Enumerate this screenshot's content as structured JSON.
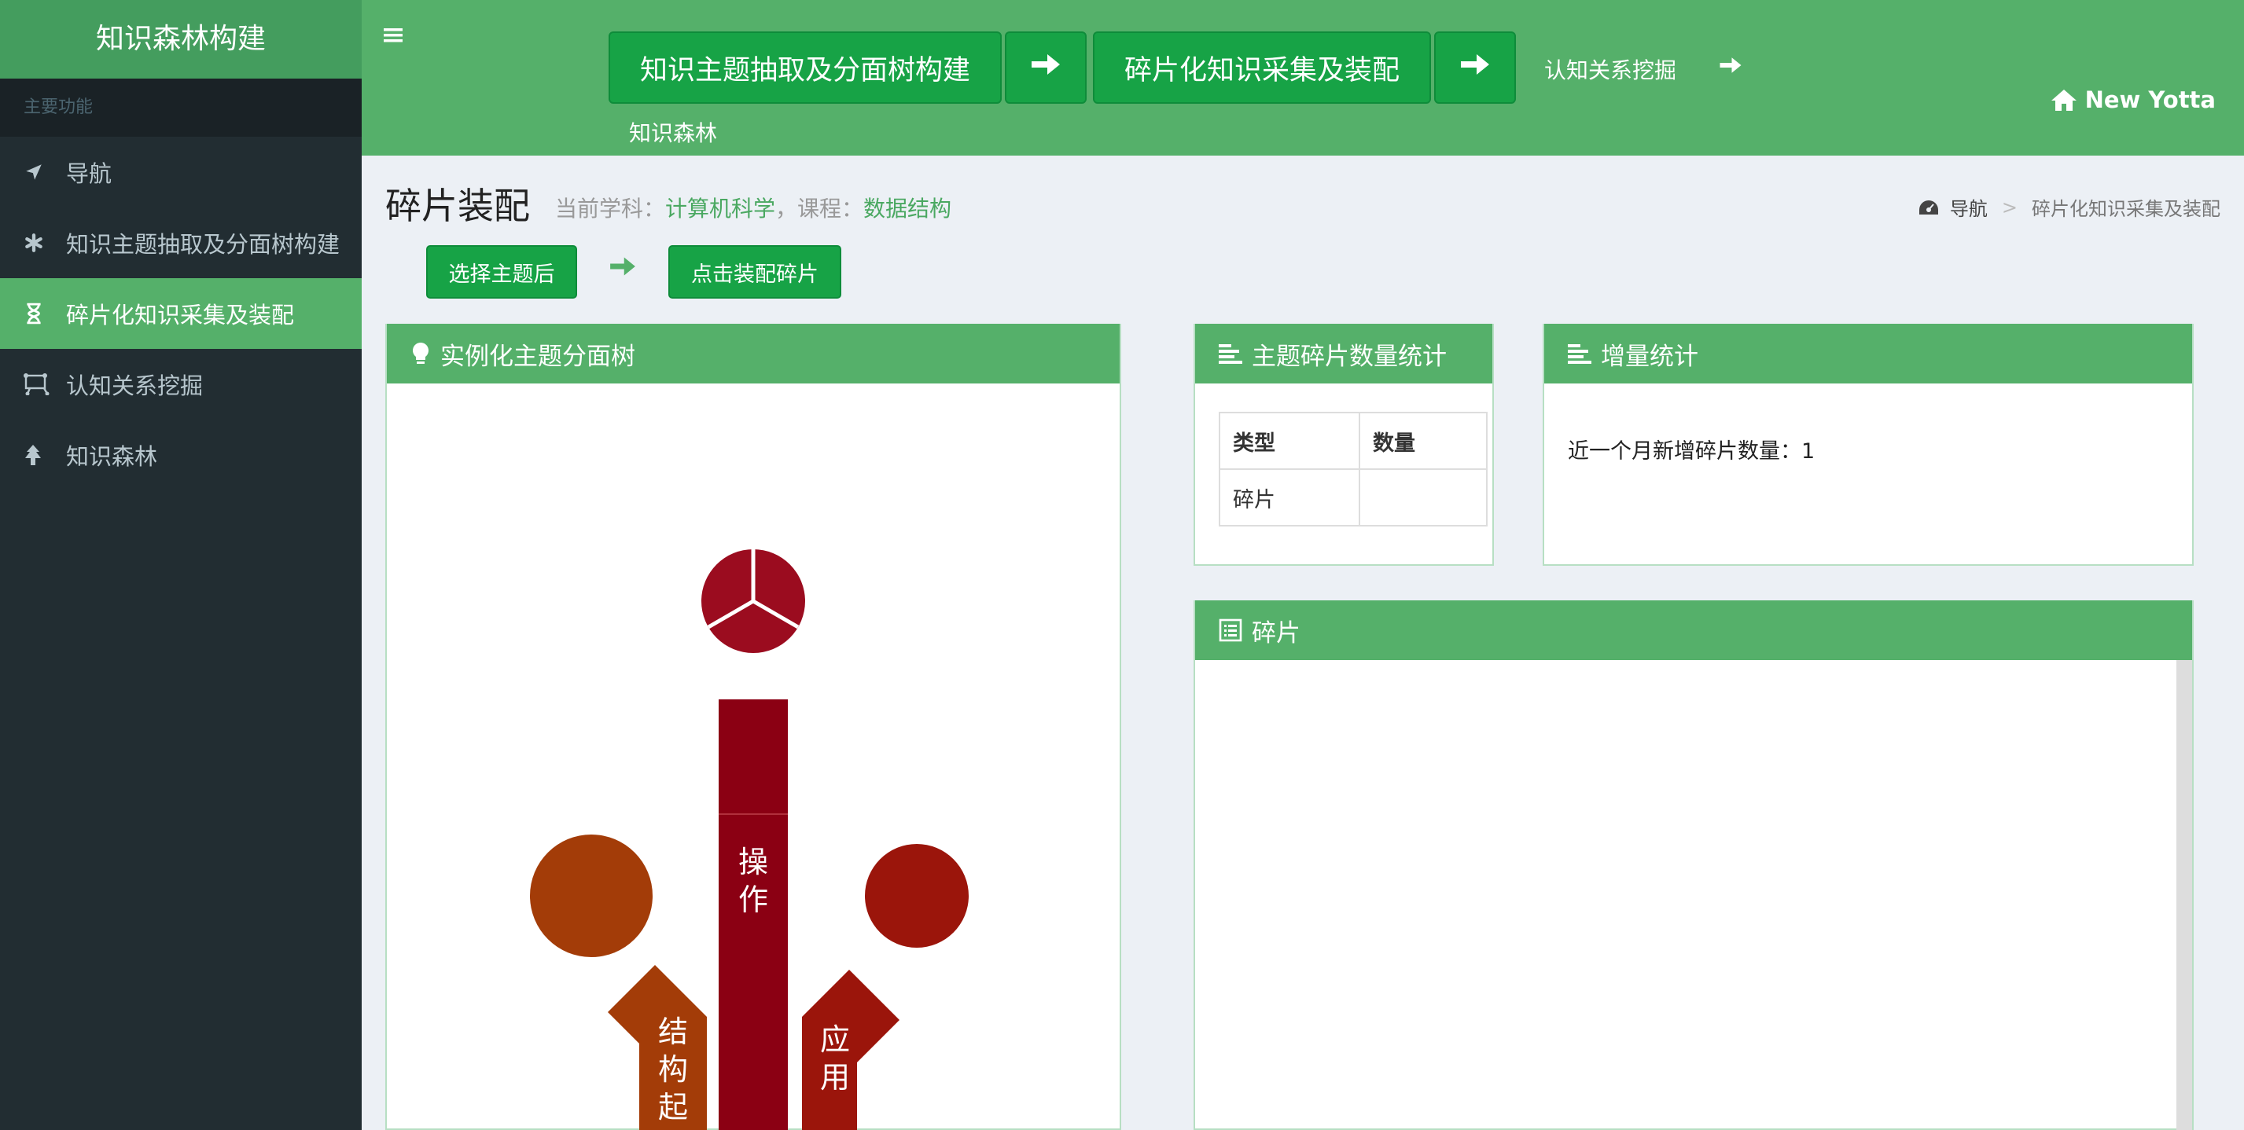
{
  "app": {
    "title": "知识森林构建"
  },
  "sidebar": {
    "header": "主要功能",
    "items": [
      {
        "label": "导航",
        "icon": "navigation-arrow-icon"
      },
      {
        "label": "知识主题抽取及分面树构建",
        "icon": "asterisk-icon"
      },
      {
        "label": "碎片化知识采集及装配",
        "icon": "hourglass-icon",
        "active": true
      },
      {
        "label": "认知关系挖掘",
        "icon": "network-icon"
      },
      {
        "label": "知识森林",
        "icon": "tree-icon"
      }
    ]
  },
  "topnav": {
    "steps": [
      "知识主题抽取及分面树构建",
      "碎片化知识采集及装配"
    ],
    "link1": "认知关系挖掘",
    "link2": "知识森林",
    "brand": "New Yotta"
  },
  "page": {
    "title": "碎片装配",
    "subject_label": "当前学科：",
    "subject": "计算机科学",
    "course_label": "，课程：",
    "course": "数据结构",
    "breadcrumb": [
      "导航",
      "碎片化知识采集及装配"
    ],
    "btn_select": "选择主题后",
    "btn_assemble": "点击装配碎片"
  },
  "panels": {
    "tree": {
      "title": "实例化主题分面树",
      "labels": [
        "操作",
        "结构起源",
        "应用"
      ]
    },
    "stats": {
      "title": "主题碎片数量统计",
      "header": [
        "类型",
        "数量"
      ],
      "row": [
        "碎片",
        ""
      ]
    },
    "increment": {
      "title": "增量统计",
      "text": "近一个月新增碎片数量：1"
    },
    "fragments": {
      "title": "碎片"
    }
  },
  "colors": {
    "green": "#55b06a",
    "button": "#17a346",
    "sidebar": "#222d32",
    "tree_dark": "#8b0013",
    "tree_orange": "#a33c08",
    "tree_red": "#9b150b"
  }
}
